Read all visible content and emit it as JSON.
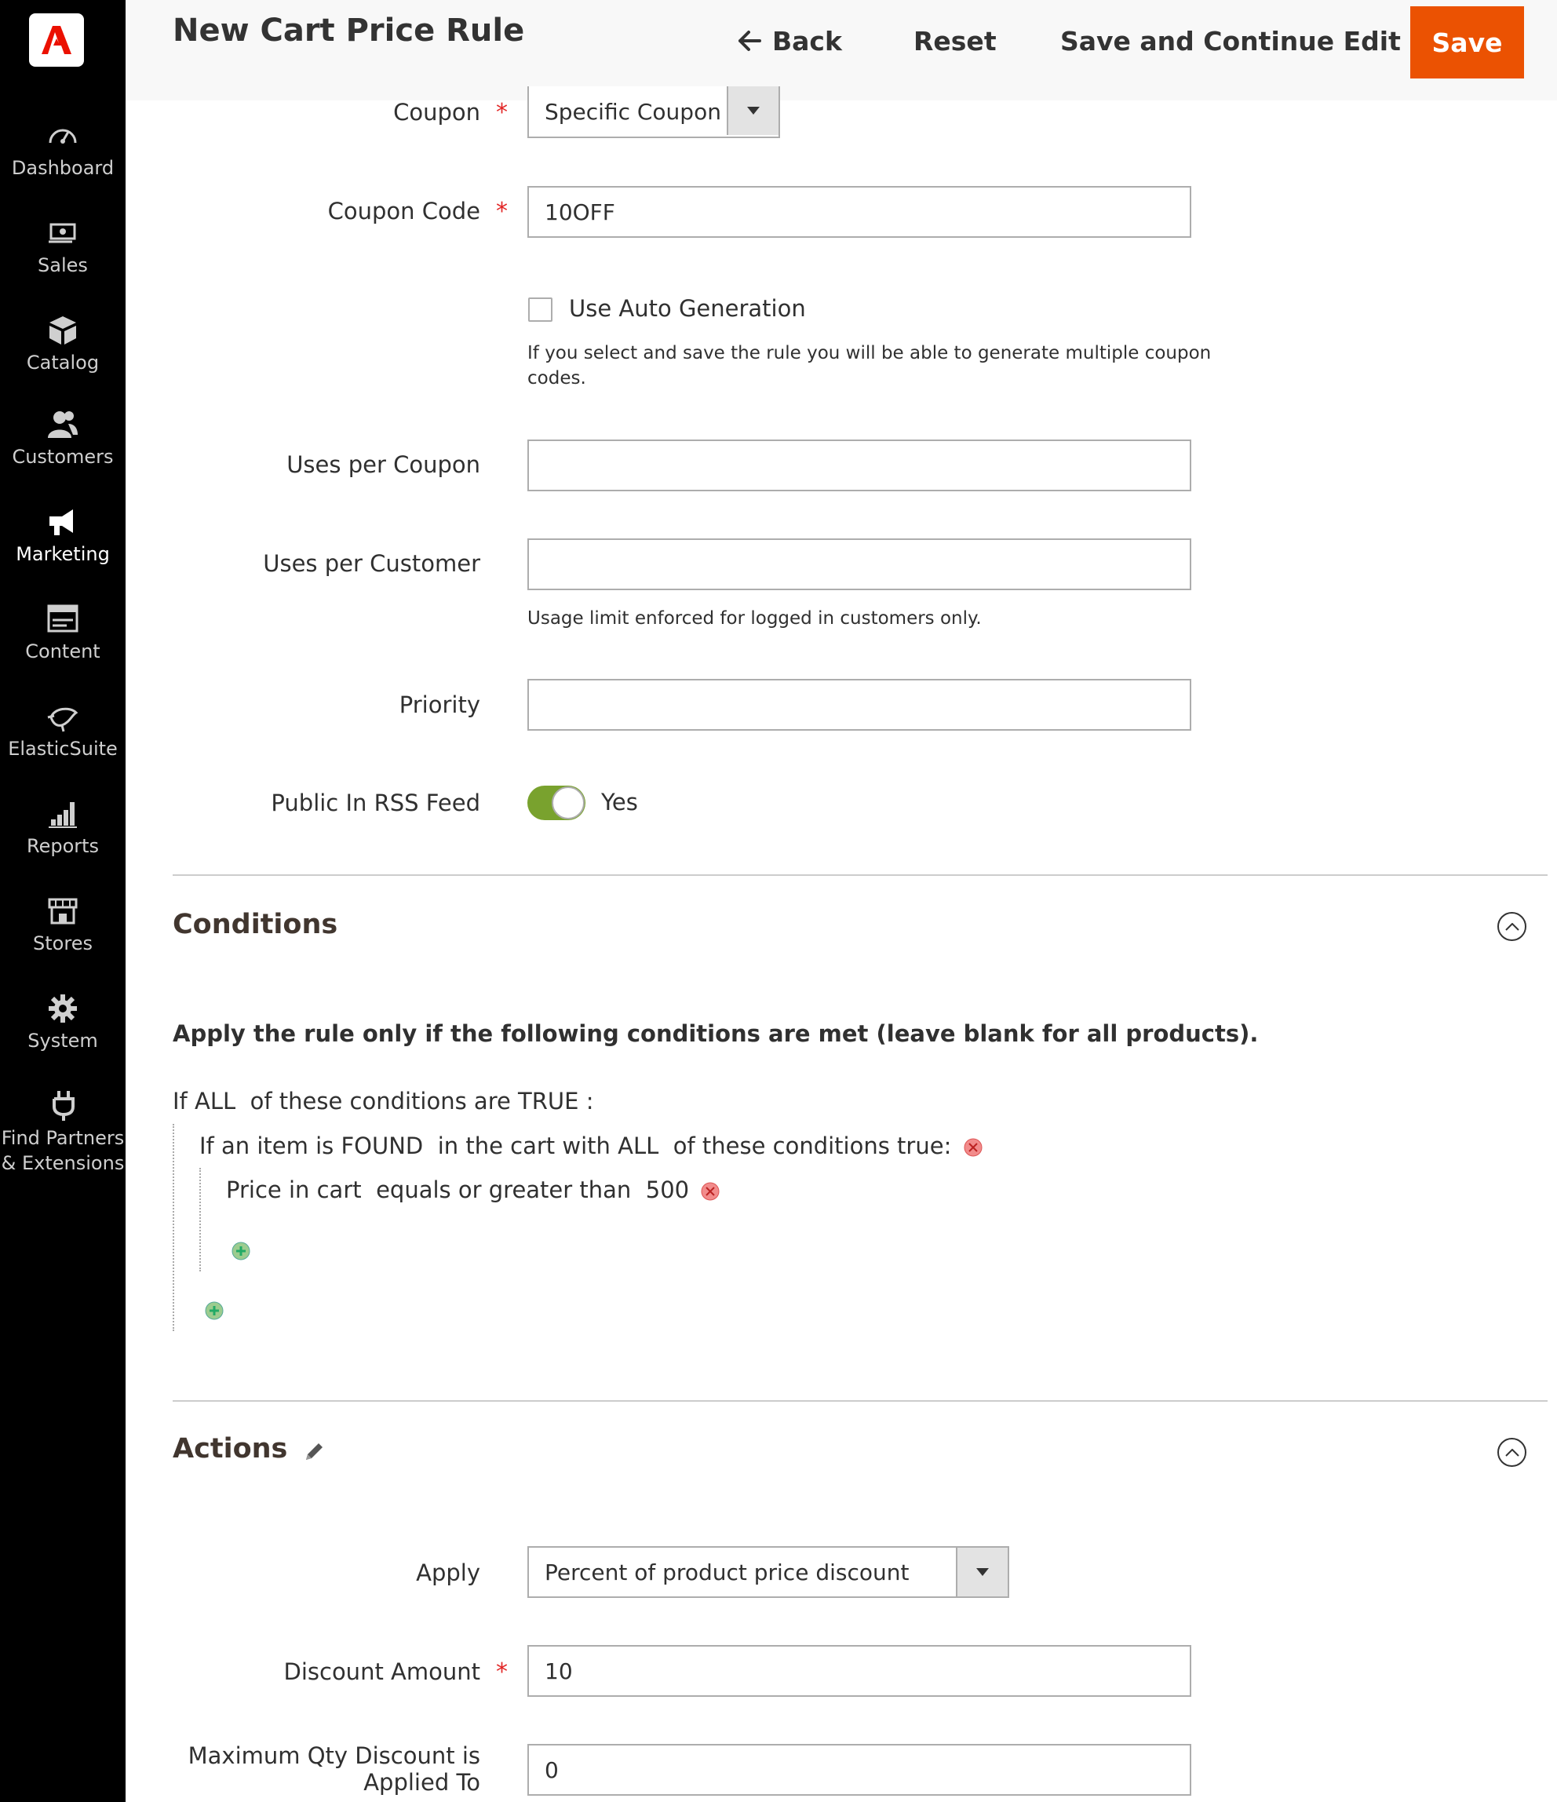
{
  "header": {
    "title": "New Cart Price Rule",
    "back_label": "Back",
    "reset_label": "Reset",
    "save_continue_label": "Save and Continue Edit",
    "save_label": "Save"
  },
  "sidebar": {
    "items": [
      {
        "label": "Dashboard",
        "icon": "dashboard-icon"
      },
      {
        "label": "Sales",
        "icon": "sales-icon"
      },
      {
        "label": "Catalog",
        "icon": "catalog-icon"
      },
      {
        "label": "Customers",
        "icon": "customers-icon"
      },
      {
        "label": "Marketing",
        "icon": "marketing-icon"
      },
      {
        "label": "Content",
        "icon": "content-icon"
      },
      {
        "label": "ElasticSuite",
        "icon": "elasticsuite-icon"
      },
      {
        "label": "Reports",
        "icon": "reports-icon"
      },
      {
        "label": "Stores",
        "icon": "stores-icon"
      },
      {
        "label": "System",
        "icon": "system-icon"
      },
      {
        "label": "Find Partners",
        "label2": "& Extensions",
        "icon": "extensions-icon"
      }
    ]
  },
  "form": {
    "coupon_label": "Coupon",
    "coupon_value": "Specific Coupon",
    "coupon_code_label": "Coupon Code",
    "coupon_code_value": "10OFF",
    "auto_gen_label": "Use Auto Generation",
    "auto_gen_note_1": "If you select and save the rule you will be able to generate multiple coupon",
    "auto_gen_note_2": "codes.",
    "uses_per_coupon_label": "Uses per Coupon",
    "uses_per_coupon_value": "",
    "uses_per_customer_label": "Uses per Customer",
    "uses_per_customer_value": "",
    "uses_per_customer_note": "Usage limit enforced for logged in customers only.",
    "priority_label": "Priority",
    "priority_value": "",
    "rss_label": "Public In RSS Feed",
    "rss_value": "Yes",
    "required_mark": "*"
  },
  "conditions": {
    "title": "Conditions",
    "heading": "Apply the rule only if the following conditions are met (leave blank for all products).",
    "line1_a": "If",
    "line1_b": "ALL",
    "line1_c": "of these conditions are",
    "line1_d": "TRUE",
    "line1_e": ":",
    "line2_a": "If an item is",
    "line2_b": "FOUND",
    "line2_c": "in the cart with",
    "line2_d": "ALL",
    "line2_e": "of these conditions true:",
    "line3_a": "Price in cart",
    "line3_b": "equals or greater than",
    "line3_c": "500"
  },
  "actions": {
    "title": "Actions",
    "apply_label": "Apply",
    "apply_value": "Percent of product price discount",
    "discount_amount_label": "Discount Amount",
    "discount_amount_value": "10",
    "max_qty_label_1": "Maximum Qty Discount is",
    "max_qty_label_2": "Applied To",
    "max_qty_value": "0"
  },
  "colors": {
    "accent": "#eb5202",
    "sidebar_bg": "#000000",
    "toggle_on": "#79a22e",
    "required": "#e22626"
  }
}
